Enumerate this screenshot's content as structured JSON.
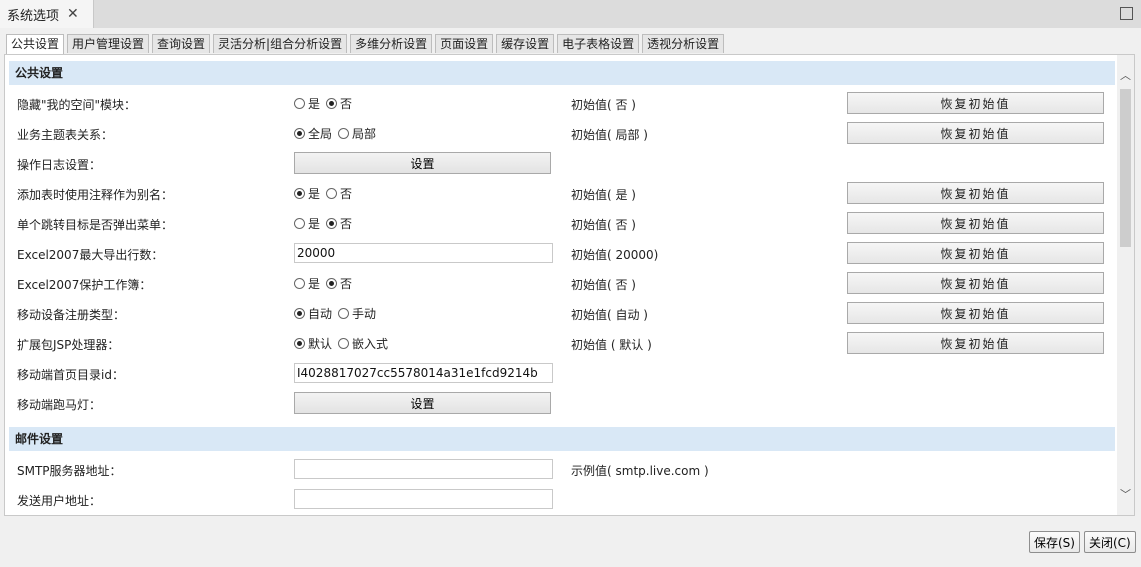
{
  "window": {
    "tab_title": "系统选项",
    "close_symbol": "✕"
  },
  "tabs": [
    {
      "label": "公共设置",
      "active": true
    },
    {
      "label": "用户管理设置"
    },
    {
      "label": "查询设置"
    },
    {
      "label": "灵活分析|组合分析设置"
    },
    {
      "label": "多维分析设置"
    },
    {
      "label": "页面设置"
    },
    {
      "label": "缓存设置"
    },
    {
      "label": "电子表格设置"
    },
    {
      "label": "透视分析设置"
    }
  ],
  "sections": {
    "public": "公共设置",
    "mail": "邮件设置"
  },
  "restore_label": "恢复初始值",
  "set_label": "设置",
  "rows": {
    "hide_space": {
      "label": "隐藏\"我的空间\"模块：",
      "opt1": "是",
      "opt2": "否",
      "initial": "初始值( 否 )"
    },
    "subject_rel": {
      "label": "业务主题表关系：",
      "opt1": "全局",
      "opt2": "局部",
      "initial": "初始值( 局部 )"
    },
    "op_log": {
      "label": "操作日志设置："
    },
    "alias": {
      "label": "添加表时使用注释作为别名：",
      "opt1": "是",
      "opt2": "否",
      "initial": "初始值( 是 )"
    },
    "jump_menu": {
      "label": "单个跳转目标是否弹出菜单：",
      "opt1": "是",
      "opt2": "否",
      "initial": "初始值( 否 )"
    },
    "excel_rows": {
      "label": "Excel2007最大导出行数：",
      "value": "20000",
      "initial": "初始值( 20000)"
    },
    "excel_protect": {
      "label": "Excel2007保护工作簿：",
      "opt1": "是",
      "opt2": "否",
      "initial": "初始值( 否 )"
    },
    "mobile_reg": {
      "label": "移动设备注册类型：",
      "opt1": "自动",
      "opt2": "手动",
      "initial": "初始值( 自动 )"
    },
    "jsp": {
      "label": "扩展包JSP处理器：",
      "opt1": "默认",
      "opt2": "嵌入式",
      "initial": "初始值 ( 默认 )"
    },
    "mobile_home": {
      "label": "移动端首页目录id：",
      "value": "I4028817027cc5578014a31e1fcd9214b"
    },
    "marquee": {
      "label": "移动端跑马灯："
    },
    "smtp": {
      "label": "SMTP服务器地址：",
      "value": "",
      "initial": "示例值( smtp.live.com )"
    },
    "sender": {
      "label": "发送用户地址：",
      "value": ""
    }
  },
  "footer": {
    "save": "保存(S)",
    "close": "关闭(C)"
  }
}
